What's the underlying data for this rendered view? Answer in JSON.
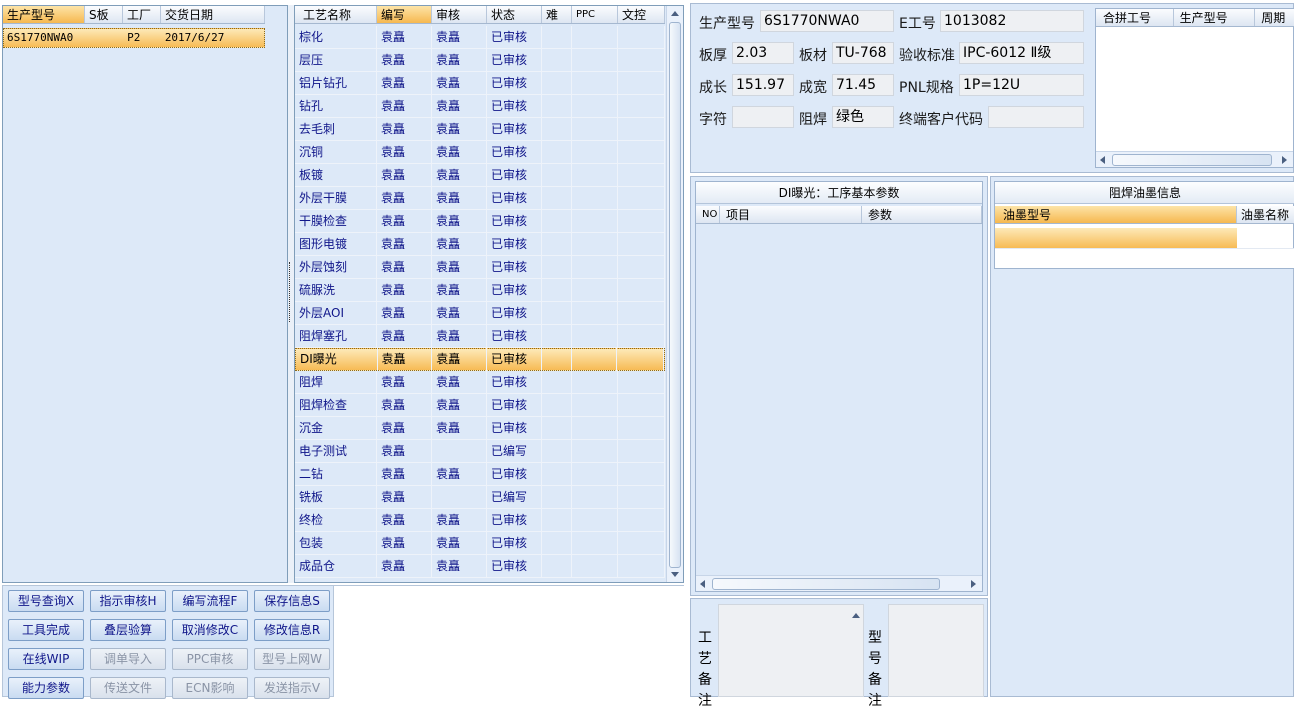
{
  "left_grid": {
    "columns": [
      "生产型号",
      "S板",
      "工厂",
      "交货日期"
    ],
    "rows": [
      {
        "model": "6S1770NWA0",
        "s": "",
        "factory": "P2",
        "date": "2017/6/27"
      }
    ]
  },
  "process_grid": {
    "columns": [
      "工艺名称",
      "编写",
      "审核",
      "状态",
      "难",
      "PPC",
      "文控"
    ],
    "rows": [
      {
        "name": "棕化",
        "writer": "袁矗",
        "reviewer": "袁矗",
        "status": "已审核"
      },
      {
        "name": "层压",
        "writer": "袁矗",
        "reviewer": "袁矗",
        "status": "已审核"
      },
      {
        "name": "铝片钻孔",
        "writer": "袁矗",
        "reviewer": "袁矗",
        "status": "已审核"
      },
      {
        "name": "钻孔",
        "writer": "袁矗",
        "reviewer": "袁矗",
        "status": "已审核"
      },
      {
        "name": "去毛刺",
        "writer": "袁矗",
        "reviewer": "袁矗",
        "status": "已审核"
      },
      {
        "name": "沉铜",
        "writer": "袁矗",
        "reviewer": "袁矗",
        "status": "已审核"
      },
      {
        "name": "板镀",
        "writer": "袁矗",
        "reviewer": "袁矗",
        "status": "已审核"
      },
      {
        "name": "外层干膜",
        "writer": "袁矗",
        "reviewer": "袁矗",
        "status": "已审核"
      },
      {
        "name": "干膜检查",
        "writer": "袁矗",
        "reviewer": "袁矗",
        "status": "已审核"
      },
      {
        "name": "图形电镀",
        "writer": "袁矗",
        "reviewer": "袁矗",
        "status": "已审核"
      },
      {
        "name": "外层蚀刻",
        "writer": "袁矗",
        "reviewer": "袁矗",
        "status": "已审核"
      },
      {
        "name": "硫脲洗",
        "writer": "袁矗",
        "reviewer": "袁矗",
        "status": "已审核"
      },
      {
        "name": "外层AOI",
        "writer": "袁矗",
        "reviewer": "袁矗",
        "status": "已审核"
      },
      {
        "name": "阻焊塞孔",
        "writer": "袁矗",
        "reviewer": "袁矗",
        "status": "已审核"
      },
      {
        "name": "DI曝光",
        "writer": "袁矗",
        "reviewer": "袁矗",
        "status": "已审核"
      },
      {
        "name": "阻焊",
        "writer": "袁矗",
        "reviewer": "袁矗",
        "status": "已审核"
      },
      {
        "name": "阻焊检查",
        "writer": "袁矗",
        "reviewer": "袁矗",
        "status": "已审核"
      },
      {
        "name": "沉金",
        "writer": "袁矗",
        "reviewer": "袁矗",
        "status": "已审核"
      },
      {
        "name": "电子测试",
        "writer": "袁矗",
        "reviewer": "",
        "status": "已编写"
      },
      {
        "name": "二钻",
        "writer": "袁矗",
        "reviewer": "袁矗",
        "status": "已审核"
      },
      {
        "name": "铣板",
        "writer": "袁矗",
        "reviewer": "",
        "status": "已编写"
      },
      {
        "name": "终检",
        "writer": "袁矗",
        "reviewer": "袁矗",
        "status": "已审核"
      },
      {
        "name": "包装",
        "writer": "袁矗",
        "reviewer": "袁矗",
        "status": "已审核"
      },
      {
        "name": "成品仓",
        "writer": "袁矗",
        "reviewer": "袁矗",
        "status": "已审核"
      }
    ]
  },
  "buttons": [
    {
      "label": "型号查询X",
      "enabled": true
    },
    {
      "label": "指示审核H",
      "enabled": true
    },
    {
      "label": "编写流程F",
      "enabled": true
    },
    {
      "label": "保存信息S",
      "enabled": true
    },
    {
      "label": "工具完成",
      "enabled": true
    },
    {
      "label": "叠层验算",
      "enabled": true
    },
    {
      "label": "取消修改C",
      "enabled": true
    },
    {
      "label": "修改信息R",
      "enabled": true
    },
    {
      "label": "在线WIP",
      "enabled": true
    },
    {
      "label": "调单导入",
      "enabled": false
    },
    {
      "label": "PPC审核",
      "enabled": false
    },
    {
      "label": "型号上网W",
      "enabled": false
    },
    {
      "label": "能力参数",
      "enabled": true
    },
    {
      "label": "传送文件",
      "enabled": false
    },
    {
      "label": "ECN影响",
      "enabled": false
    },
    {
      "label": "发送指示V",
      "enabled": false
    }
  ],
  "info": {
    "model_label": "生产型号",
    "model": "6S1770NWA0",
    "e_label": "E工号",
    "e_no": "1013082",
    "thick_label": "板厚",
    "thick": "2.03",
    "material_label": "板材",
    "material": "TU-768",
    "std_label": "验收标准",
    "std": "IPC-6012 Ⅱ级",
    "len_label": "成长",
    "len": "151.97",
    "wid_label": "成宽",
    "wid": "71.45",
    "pnl_label": "PNL规格",
    "pnl": "1P=12U",
    "char_label": "字符",
    "char": "",
    "mask_label": "阻焊",
    "mask": "绿色",
    "cust_label": "终端客户代码",
    "cust": ""
  },
  "merge_grid": {
    "columns": [
      "合拼工号",
      "生产型号",
      "周期"
    ]
  },
  "di_panel": {
    "title": "DI曝光：工序基本参数",
    "columns": [
      "NO",
      "项目",
      "参数"
    ]
  },
  "ink_panel": {
    "title": "阻焊油墨信息",
    "columns": [
      "油墨型号",
      "油墨名称"
    ]
  },
  "notes": {
    "process_label": "工艺备注",
    "model_label": "型号备注"
  }
}
